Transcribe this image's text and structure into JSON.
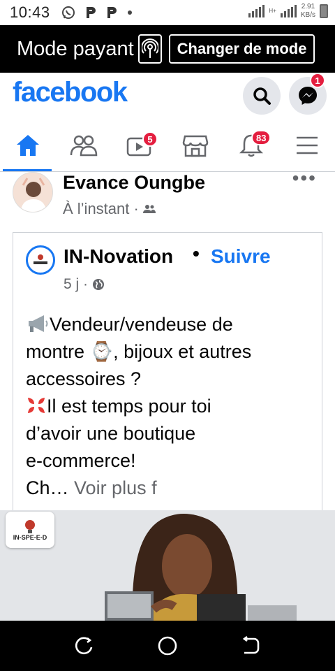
{
  "status_bar": {
    "time": "10:43",
    "network_type": "H+",
    "speed_value": "2.91",
    "speed_unit": "KB/s"
  },
  "mode_bar": {
    "label": "Mode payant",
    "button_label": "Changer de mode"
  },
  "header": {
    "logo": "facebook",
    "messenger_badge": "1",
    "brand_color": "#1877f2"
  },
  "nav_tabs": [
    {
      "name": "home",
      "icon": "home-icon",
      "badge": ""
    },
    {
      "name": "friends",
      "icon": "friends-icon",
      "badge": ""
    },
    {
      "name": "watch",
      "icon": "video-icon",
      "badge": "5"
    },
    {
      "name": "marketplace",
      "icon": "store-icon",
      "badge": ""
    },
    {
      "name": "notifications",
      "icon": "bell-icon",
      "badge": "83"
    },
    {
      "name": "menu",
      "icon": "menu-icon",
      "badge": ""
    }
  ],
  "post": {
    "author": "Evance Oungbe",
    "time": "À l’instant ·",
    "more": "•••",
    "shared": {
      "page_name": "IN-Novation",
      "separator": "•",
      "follow_label": "Suivre",
      "time": "5 j ·",
      "lines": [
        "Vendeur/vendeuse de",
        "montre ⌚, bijoux et autres",
        "accessoires ?",
        "Il est temps pour toi",
        "d’avoir une boutique",
        "e-commerce!"
      ],
      "truncated": "Ch…",
      "see_more": "Voir plus f"
    },
    "image_logo_text": "IN-SPE-E-D"
  }
}
